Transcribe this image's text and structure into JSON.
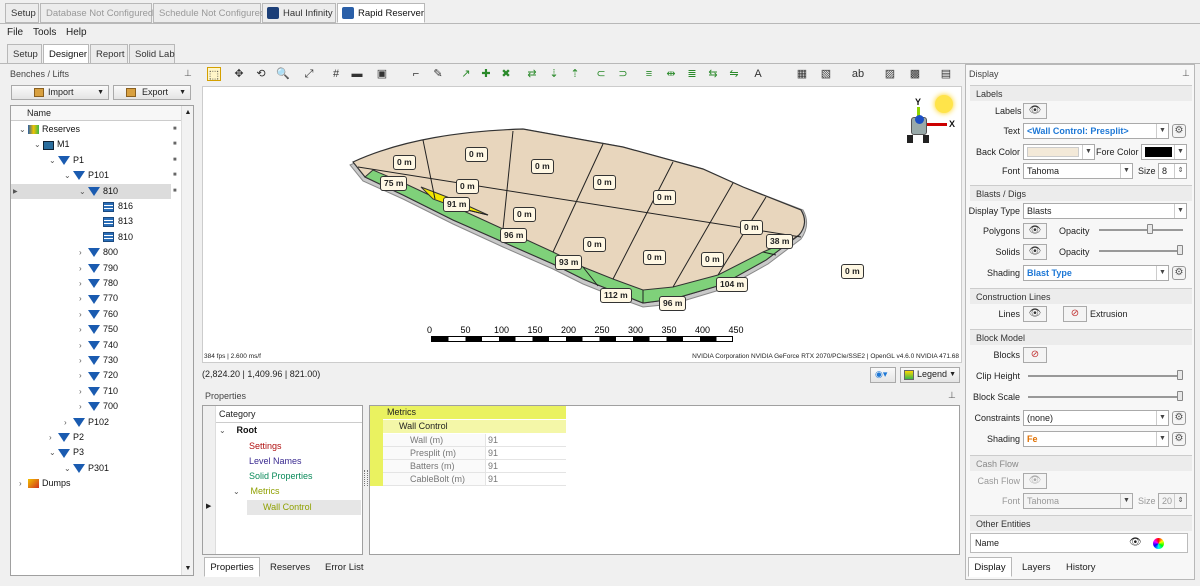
{
  "app_tabs": [
    "Setup",
    "Database Not Configured",
    "Schedule Not Configured",
    "Haul Infinity",
    "Rapid Reserver"
  ],
  "menu": [
    "File",
    "Tools",
    "Help"
  ],
  "sub_tabs": [
    "Setup",
    "Designer",
    "Report",
    "Solid Lab"
  ],
  "left_panel": {
    "title": "Benches / Lifts",
    "import_label": "Import",
    "export_label": "Export",
    "column": "Name",
    "tree": [
      {
        "label": "Reserves",
        "depth": 0,
        "icon": "reserves"
      },
      {
        "label": "M1",
        "depth": 1,
        "icon": "model"
      },
      {
        "label": "P1",
        "depth": 2,
        "icon": "pit"
      },
      {
        "label": "P101",
        "depth": 3,
        "icon": "pit"
      },
      {
        "label": "810",
        "depth": 4,
        "icon": "pit"
      },
      {
        "label": "816",
        "depth": 5,
        "icon": "bench"
      },
      {
        "label": "813",
        "depth": 5,
        "icon": "bench"
      },
      {
        "label": "810",
        "depth": 5,
        "icon": "bench"
      },
      {
        "label": "800",
        "depth": 4,
        "icon": "pit"
      },
      {
        "label": "790",
        "depth": 4,
        "icon": "pit"
      },
      {
        "label": "780",
        "depth": 4,
        "icon": "pit"
      },
      {
        "label": "770",
        "depth": 4,
        "icon": "pit"
      },
      {
        "label": "760",
        "depth": 4,
        "icon": "pit"
      },
      {
        "label": "750",
        "depth": 4,
        "icon": "pit"
      },
      {
        "label": "740",
        "depth": 4,
        "icon": "pit"
      },
      {
        "label": "730",
        "depth": 4,
        "icon": "pit"
      },
      {
        "label": "720",
        "depth": 4,
        "icon": "pit"
      },
      {
        "label": "710",
        "depth": 4,
        "icon": "pit"
      },
      {
        "label": "700",
        "depth": 4,
        "icon": "pit"
      },
      {
        "label": "P102",
        "depth": 3,
        "icon": "pit"
      },
      {
        "label": "P2",
        "depth": 2,
        "icon": "pit"
      },
      {
        "label": "P3",
        "depth": 2,
        "icon": "pit"
      },
      {
        "label": "P301",
        "depth": 3,
        "icon": "pit"
      },
      {
        "label": "Dumps",
        "depth": 0,
        "icon": "dumps"
      }
    ]
  },
  "viewport": {
    "status_left": "384 fps | 2.600 ms/f",
    "status_right": "NVIDIA Corporation NVIDIA GeForce RTX 2070/PCIe/SSE2 | OpenGL v4.6.0 NVIDIA 471.68",
    "coords": "(2,824.20 | 1,409.96 | 821.00)",
    "legend_label": "Legend",
    "scale_ticks": [
      "0",
      "50",
      "100",
      "150",
      "200",
      "250",
      "300",
      "350",
      "400",
      "450"
    ],
    "axis_x": "X",
    "axis_y": "Y",
    "block_labels": [
      "0 m",
      "0 m",
      "0 m",
      "0 m",
      "0 m",
      "0 m",
      "0 m",
      "0 m",
      "0 m",
      "0 m",
      "0 m",
      "0 m",
      "75 m",
      "91 m",
      "96 m",
      "93 m",
      "112 m",
      "96 m",
      "104 m",
      "38 m"
    ]
  },
  "properties": {
    "title": "Properties",
    "category_header": "Category",
    "tree": [
      "Root",
      "Settings",
      "Level Names",
      "Solid Properties",
      "Metrics",
      "Wall Control"
    ],
    "grid_header": "Metrics",
    "grid_sub": "Wall Control",
    "rows": [
      {
        "name": "Wall (m)",
        "value": "91"
      },
      {
        "name": "Presplit (m)",
        "value": "91"
      },
      {
        "name": "Batters (m)",
        "value": "91"
      },
      {
        "name": "CableBolt (m)",
        "value": "91"
      }
    ],
    "bottom_tabs": [
      "Properties",
      "Reserves",
      "Error List"
    ]
  },
  "display": {
    "title": "Display",
    "sections": {
      "labels": "Labels",
      "blasts": "Blasts / Digs",
      "construction": "Construction Lines",
      "block_model": "Block Model",
      "cash_flow": "Cash Flow",
      "other": "Other Entities"
    },
    "labels_label": "Labels",
    "text_label": "Text",
    "text_value": "<Wall Control: Presplit>",
    "back_color_label": "Back Color",
    "fore_color_label": "Fore Color",
    "font_label": "Font",
    "font_value": "Tahoma",
    "size_label": "Size",
    "size_value": "8",
    "display_type_label": "Display Type",
    "display_type_value": "Blasts",
    "polygons_label": "Polygons",
    "solids_label": "Solids",
    "opacity_label": "Opacity",
    "shading_label": "Shading",
    "shading_value": "Blast Type",
    "lines_label": "Lines",
    "extrusion_label": "Extrusion",
    "blocks_label": "Blocks",
    "clip_height_label": "Clip Height",
    "block_scale_label": "Block Scale",
    "constraints_label": "Constraints",
    "constraints_value": "(none)",
    "bm_shading_value": "Fe",
    "cash_flow_label": "Cash Flow",
    "cf_font_value": "Tahoma",
    "cf_size_value": "20",
    "name_label": "Name",
    "bottom_tabs": [
      "Display",
      "Layers",
      "History"
    ]
  },
  "colors": {
    "accent": "#1e78d6",
    "highlight": "#e8f25a",
    "green": "#7fd17a",
    "tan": "#e6d3b8",
    "yellow": "#f2e600"
  }
}
